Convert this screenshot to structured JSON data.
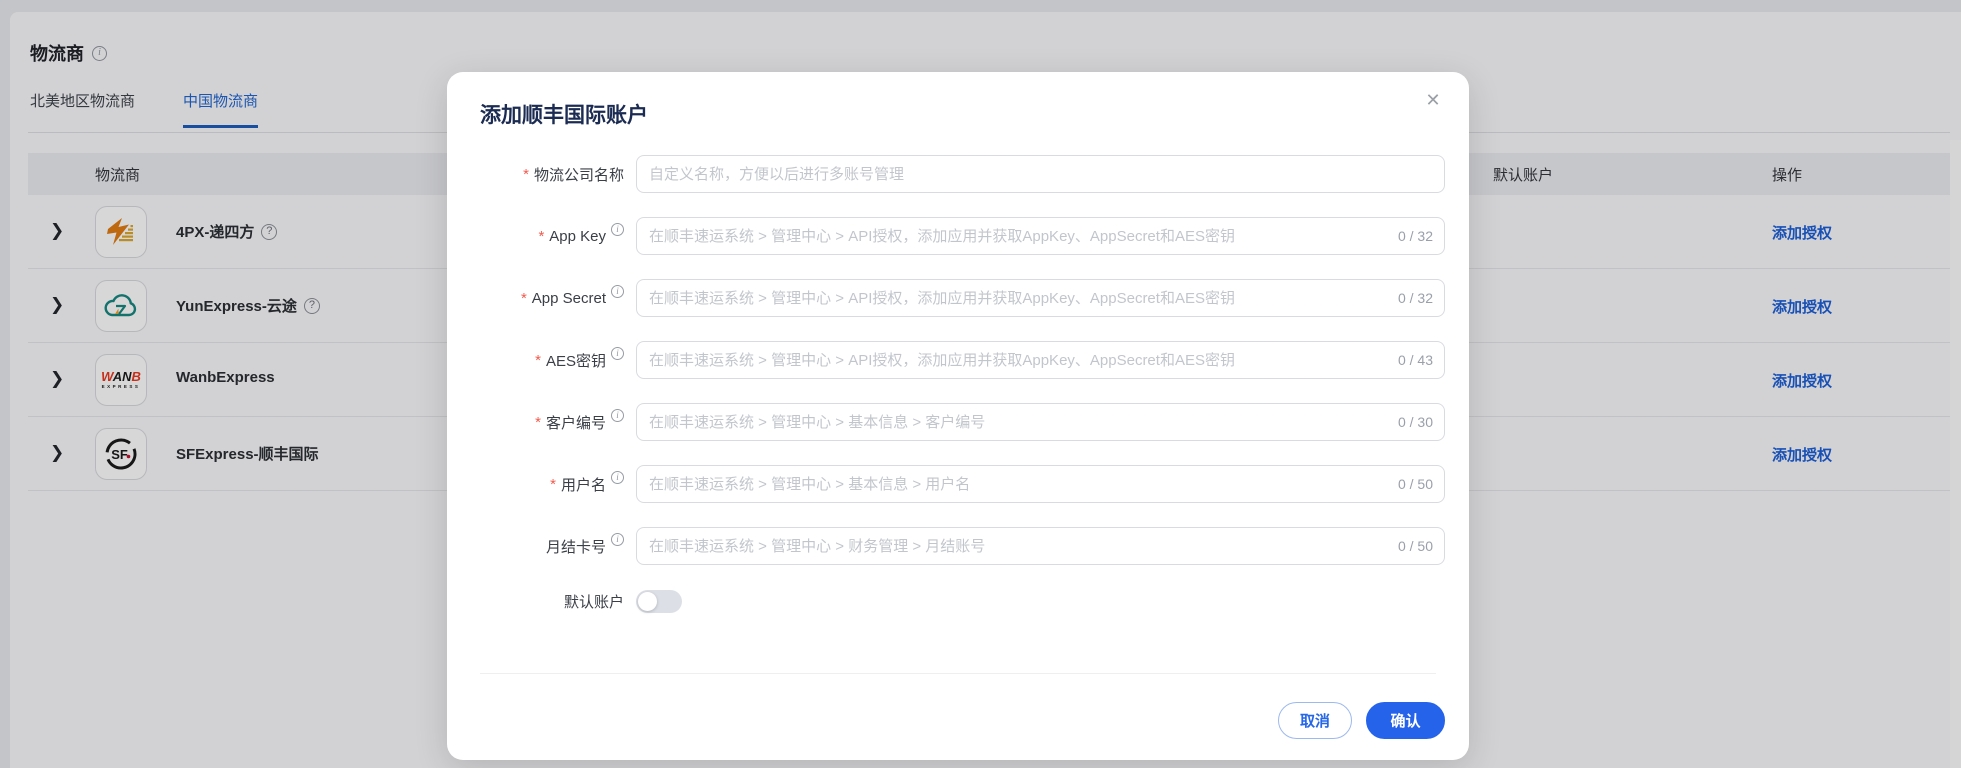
{
  "page": {
    "title": "物流商",
    "title_info_icon": "info-icon",
    "tabs": [
      {
        "label": "北美地区物流商",
        "active": false
      },
      {
        "label": "中国物流商",
        "active": true
      }
    ],
    "table": {
      "columns": {
        "provider": "物流商",
        "default_account": "默认账户",
        "action": "操作"
      },
      "rows": [
        {
          "name": "4PX-递四方",
          "logo": "4px",
          "has_help": true,
          "action": "添加授权"
        },
        {
          "name": "YunExpress-云途",
          "logo": "yunexpress",
          "has_help": true,
          "action": "添加授权"
        },
        {
          "name": "WanbExpress",
          "logo": "wanb",
          "has_help": false,
          "action": "添加授权"
        },
        {
          "name": "SFExpress-顺丰国际",
          "logo": "sf",
          "has_help": false,
          "action": "添加授权"
        }
      ]
    }
  },
  "modal": {
    "title": "添加顺丰国际账户",
    "close_icon": "✕",
    "fields": [
      {
        "label": "物流公司名称",
        "required": true,
        "info": false,
        "placeholder": "自定义名称，方便以后进行多账号管理",
        "counter": "",
        "value": ""
      },
      {
        "label": "App Key",
        "required": true,
        "info": true,
        "placeholder": "在顺丰速运系统 > 管理中心 > API授权，添加应用并获取AppKey、AppSecret和AES密钥",
        "counter": "0 / 32",
        "value": ""
      },
      {
        "label": "App Secret",
        "required": true,
        "info": true,
        "placeholder": "在顺丰速运系统 > 管理中心 > API授权，添加应用并获取AppKey、AppSecret和AES密钥",
        "counter": "0 / 32",
        "value": ""
      },
      {
        "label": "AES密钥",
        "required": true,
        "info": true,
        "placeholder": "在顺丰速运系统 > 管理中心 > API授权，添加应用并获取AppKey、AppSecret和AES密钥",
        "counter": "0 / 43",
        "value": ""
      },
      {
        "label": "客户编号",
        "required": true,
        "info": true,
        "placeholder": "在顺丰速运系统 > 管理中心 > 基本信息 > 客户编号",
        "counter": "0 / 30",
        "value": ""
      },
      {
        "label": "用户名",
        "required": true,
        "info": true,
        "placeholder": "在顺丰速运系统 > 管理中心 > 基本信息 > 用户名",
        "counter": "0 / 50",
        "value": ""
      },
      {
        "label": "月结卡号",
        "required": false,
        "info": true,
        "placeholder": "在顺丰速运系统 > 管理中心 > 财务管理 > 月结账号",
        "counter": "0 / 50",
        "value": ""
      }
    ],
    "toggle": {
      "label": "默认账户",
      "on": false
    },
    "buttons": {
      "cancel": "取消",
      "confirm": "确认"
    }
  },
  "colors": {
    "accent_tab_blue": "#2166d1",
    "link_blue": "#1d5fd6",
    "confirm_blue": "#2563eb",
    "required_red": "#f15b4f",
    "modal_title_navy": "#1b2b52"
  }
}
